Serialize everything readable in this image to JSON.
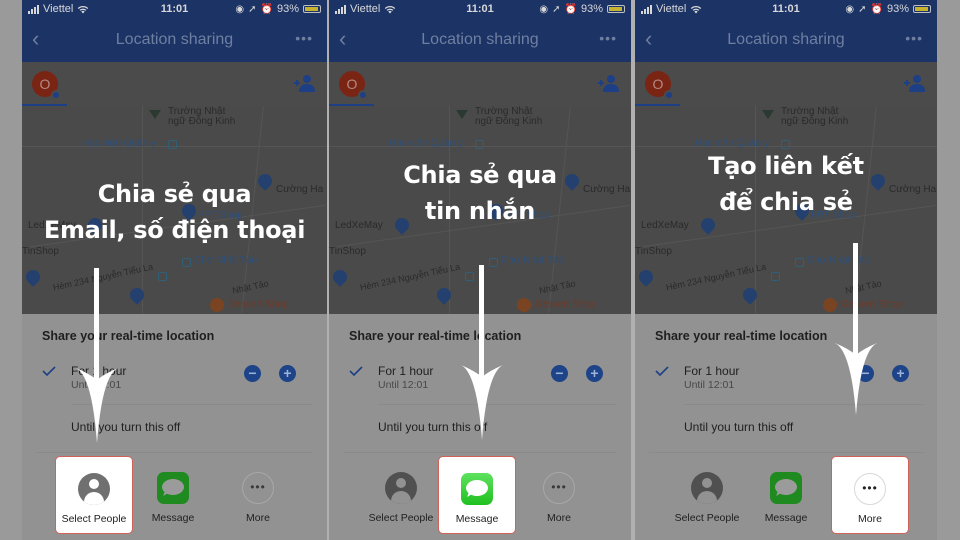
{
  "status_bar": {
    "carrier": "Viettel",
    "time": "11:01",
    "battery": "93%"
  },
  "app_bar": {
    "title": "Location sharing",
    "more_label": "•••"
  },
  "people": {
    "avatar_initial": "O"
  },
  "map_labels": {
    "school": "Trường Nhật",
    "school2": "ngữ Đông Kinh",
    "academy": "Học viện Quân y",
    "cuong": "Cường Ha",
    "fpt": "FPT Shop",
    "ledxemay": "LedXeMay",
    "tinshop": "TinShop",
    "cho": "Chợ Nhật Tảo",
    "street": "Hẻm 234 Nguyễn Tiểu La",
    "nhattao": "Nhật Tảo",
    "dessert": "Dessert Shop"
  },
  "sheet": {
    "heading": "Share your real-time location",
    "option1_title": "For 1 hour",
    "option1_sub": "Until 12:01",
    "minus": "−",
    "plus": "+",
    "option2": "Until you turn this off",
    "share_targets": [
      {
        "label": "Select People",
        "icon": "person-icon"
      },
      {
        "label": "Message",
        "icon": "message-icon"
      },
      {
        "label": "More",
        "icon": "more-icon"
      }
    ]
  },
  "panels": [
    {
      "caption_line1": "Chia sẻ qua",
      "caption_line2": "Email, số điện thoại",
      "highlighted": "Select People"
    },
    {
      "caption_line1": "Chia sẻ qua",
      "caption_line2": "tin nhắn",
      "highlighted": "Message"
    },
    {
      "caption_line1": "Tạo liên kết",
      "caption_line2": "để chia sẻ",
      "highlighted": "More"
    }
  ],
  "colors": {
    "header": "#1c3366",
    "highlight_border": "#d0625a",
    "accent_blue": "#1d4488",
    "message_green": "#20c020"
  }
}
